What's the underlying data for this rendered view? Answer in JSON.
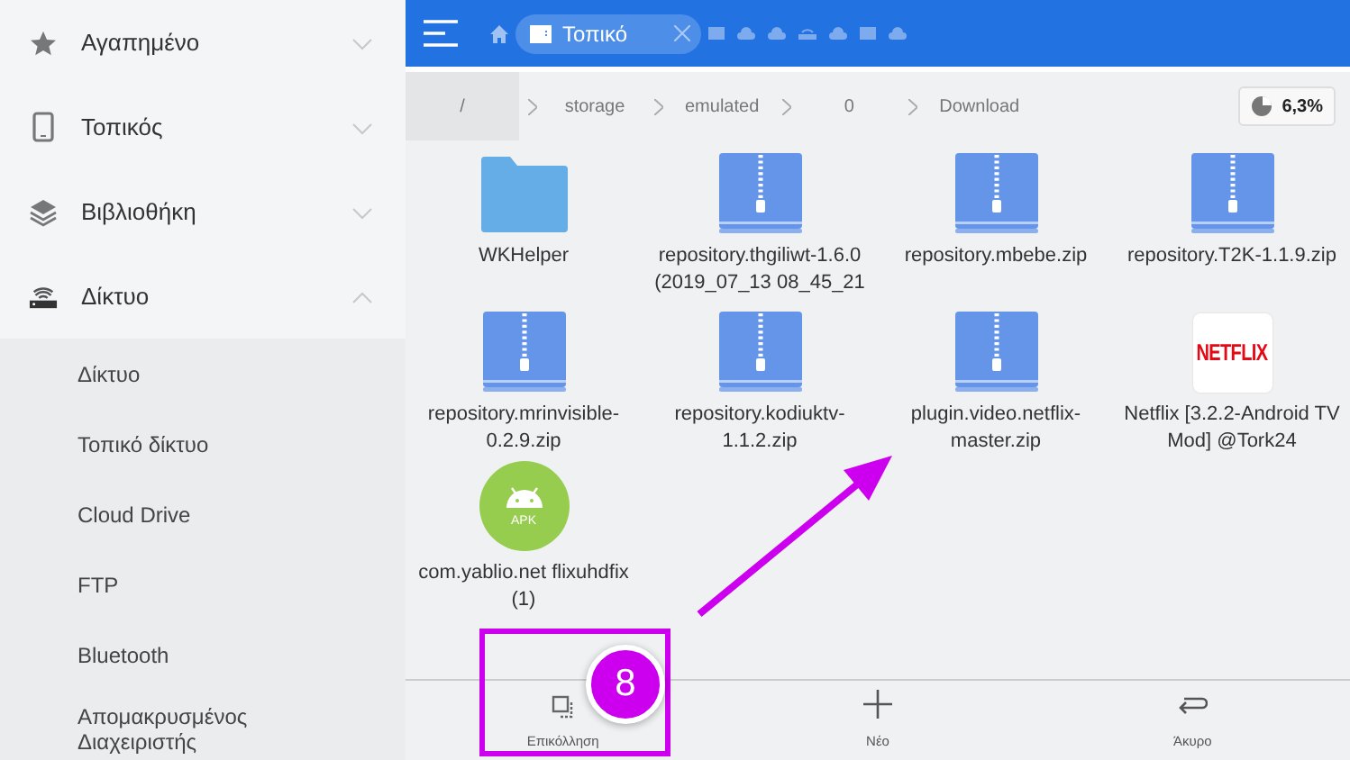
{
  "sidebar": {
    "items": [
      {
        "kind": "main",
        "label": "Αγαπημένο",
        "expanded": false
      },
      {
        "kind": "main",
        "label": "Τοπικός",
        "expanded": false
      },
      {
        "kind": "main",
        "label": "Βιβλιοθήκη",
        "expanded": false
      },
      {
        "kind": "main",
        "label": "Δίκτυο",
        "expanded": true,
        "children": [
          {
            "label": "Δίκτυο"
          },
          {
            "label": "Τοπικό δίκτυο"
          },
          {
            "label": "Cloud Drive"
          },
          {
            "label": "FTP"
          },
          {
            "label": "Bluetooth"
          },
          {
            "label": "Απομακρυσμένος Διαχειριστής"
          }
        ]
      }
    ]
  },
  "toolbar": {
    "tabs": [
      {
        "label": "Τοπικό",
        "selected": true
      }
    ]
  },
  "path": {
    "crumbs": [
      {
        "label": "/",
        "selected": true
      },
      {
        "label": "storage",
        "selected": false
      },
      {
        "label": "emulated",
        "selected": false
      },
      {
        "label": "0",
        "selected": false
      },
      {
        "label": "Download",
        "selected": false
      }
    ],
    "storage": "6,3%"
  },
  "files": [
    {
      "kind": "folder",
      "name": "WKHelper"
    },
    {
      "kind": "zip",
      "name": "repository.thgiliwt-1.6.0 (2019_07_13 08_45_21"
    },
    {
      "kind": "zip",
      "name": "repository.mbebe.zip"
    },
    {
      "kind": "zip",
      "name": "repository.T2K-1.1.9.zip"
    },
    {
      "kind": "zip",
      "name": "repository.mrinvisible-0.2.9.zip"
    },
    {
      "kind": "zip",
      "name": "repository.kodiuktv-1.1.2.zip"
    },
    {
      "kind": "zip",
      "name": "plugin.video.netflix-master.zip"
    },
    {
      "kind": "netflix",
      "name": "Netflix [3.2.2-Android TV Mod] @Tork24",
      "logo_text": "NETFLIX"
    },
    {
      "kind": "apk",
      "name": "com.yablio.net flixuhdfix (1)",
      "logo_text": "APK"
    }
  ],
  "actions": [
    {
      "label": "Επικόλληση"
    },
    {
      "label": "Νέο"
    },
    {
      "label": "Άκυρο"
    }
  ],
  "annotation": {
    "badge": "8"
  }
}
